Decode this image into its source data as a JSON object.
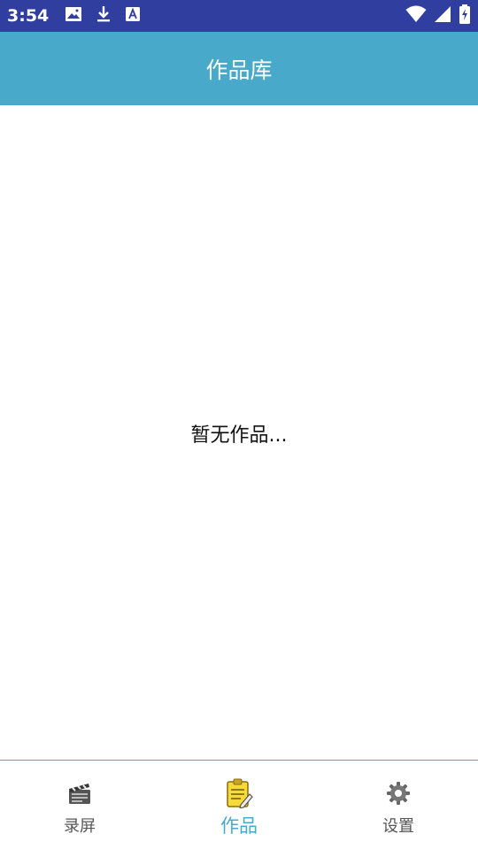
{
  "status_bar": {
    "time": "3:54",
    "left_icons": [
      "image-icon",
      "download-icon",
      "font-icon"
    ],
    "right_icons": [
      "wifi-icon",
      "signal-icon",
      "battery-charging-icon"
    ],
    "background": "#303f9f"
  },
  "app_bar": {
    "title": "作品库",
    "background": "#48a9cb"
  },
  "content": {
    "empty_message": "暂无作品..."
  },
  "bottom_nav": {
    "items": [
      {
        "label": "录屏",
        "icon": "clapperboard-icon",
        "active": false
      },
      {
        "label": "作品",
        "icon": "notepad-icon",
        "active": true
      },
      {
        "label": "设置",
        "icon": "gear-icon",
        "active": false
      }
    ],
    "active_color": "#48a9cb"
  }
}
